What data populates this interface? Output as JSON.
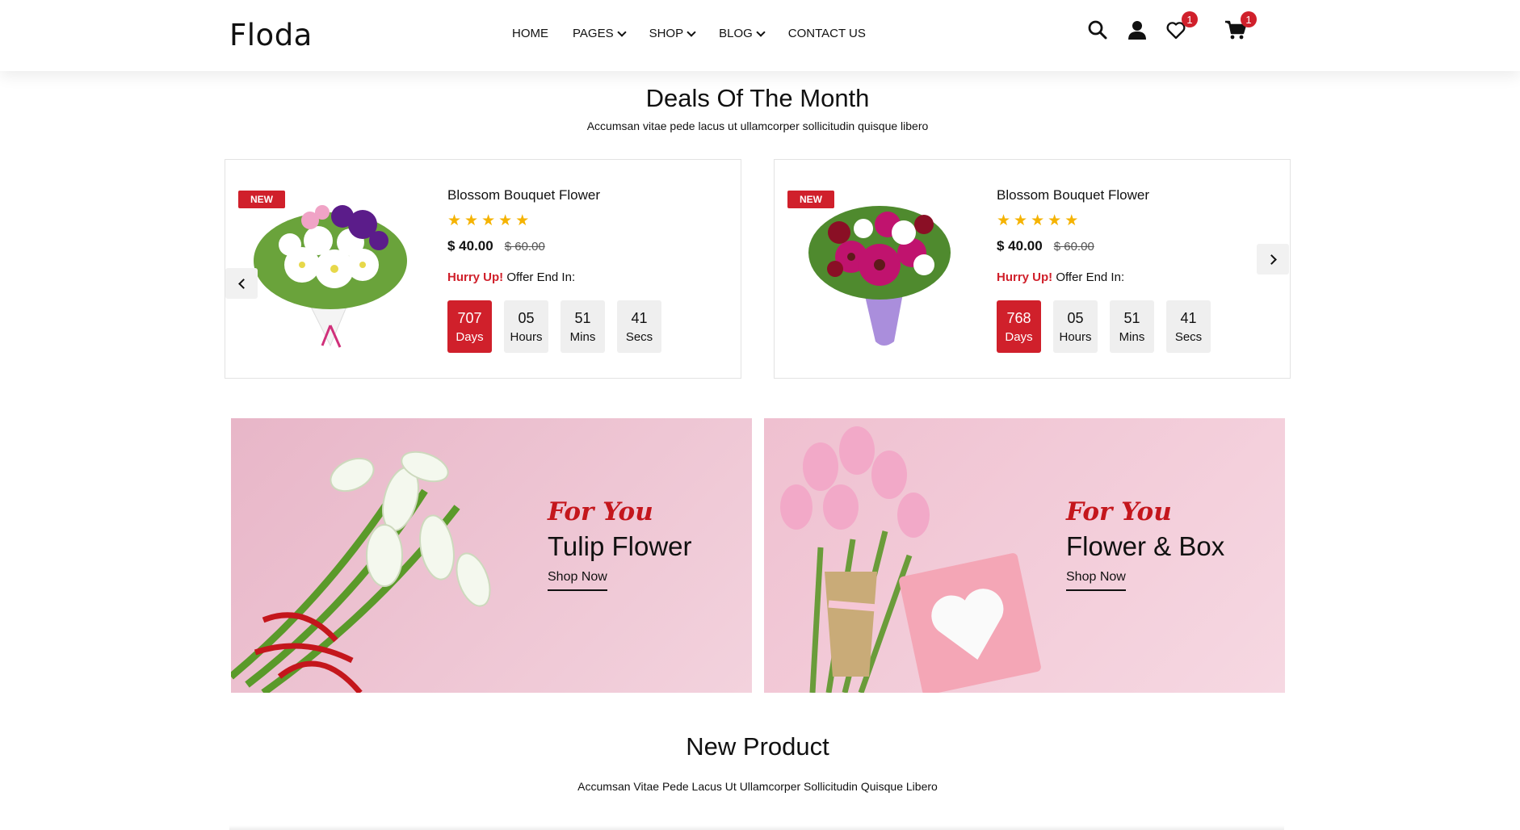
{
  "header": {
    "logo": "Floda",
    "nav": [
      "HOME",
      "PAGES",
      "SHOP",
      "BLOG",
      "CONTACT US"
    ],
    "wishlist_count": "1",
    "cart_count": "1",
    "icons": [
      "search-icon",
      "user-icon",
      "heart-icon",
      "cart-icon"
    ]
  },
  "deals": {
    "title": "Deals Of The Month",
    "subtitle": "Accumsan vitae pede lacus ut ullamcorper sollicitudin quisque libero",
    "cards": [
      {
        "badge": "NEW",
        "name": "Blossom Bouquet Flower",
        "rating": 5,
        "price": "$ 40.00",
        "old_price": "$ 60.00",
        "hurry": "Hurry Up!",
        "offer": "Offer End In:",
        "countdown": [
          {
            "value": "707",
            "label": "Days"
          },
          {
            "value": "05",
            "label": "Hours"
          },
          {
            "value": "51",
            "label": "Mins"
          },
          {
            "value": "41",
            "label": "Secs"
          }
        ]
      },
      {
        "badge": "NEW",
        "name": "Blossom Bouquet Flower",
        "rating": 5,
        "price": "$ 40.00",
        "old_price": "$ 60.00",
        "hurry": "Hurry Up!",
        "offer": "Offer End In:",
        "countdown": [
          {
            "value": "768",
            "label": "Days"
          },
          {
            "value": "05",
            "label": "Hours"
          },
          {
            "value": "51",
            "label": "Mins"
          },
          {
            "value": "41",
            "label": "Secs"
          }
        ]
      }
    ]
  },
  "banners": [
    {
      "tag": "For You",
      "title": "Tulip Flower",
      "cta": "Shop Now"
    },
    {
      "tag": "For You",
      "title": "Flower & Box",
      "cta": "Shop Now"
    }
  ],
  "new_product": {
    "title": "New Product",
    "subtitle": "Accumsan Vitae Pede Lacus Ut Ullamcorper Sollicitudin Quisque Libero"
  },
  "colors": {
    "accent": "#d0202b",
    "star": "#f5b301",
    "banner_bg": "#f2c9d6"
  }
}
